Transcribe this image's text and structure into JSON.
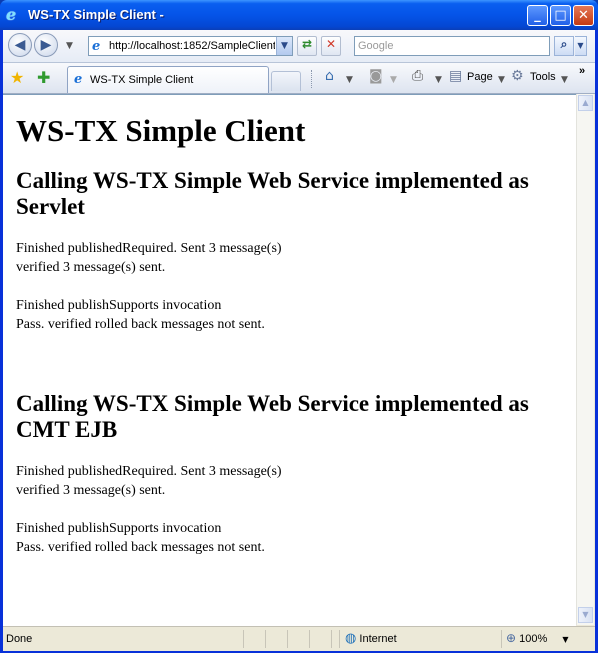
{
  "window": {
    "title": "WS-TX Simple Client -",
    "minimize_label": "_",
    "maximize_label": "□",
    "close_label": "✕"
  },
  "nav": {
    "back_glyph": "◀",
    "forward_glyph": "▶",
    "address": "http://localhost:1852/SampleClient",
    "search_placeholder": "Google"
  },
  "tabs": [
    {
      "label": "WS-TX Simple Client"
    }
  ],
  "commands": {
    "page_label": "Page",
    "tools_label": "Tools",
    "more_glyph": "»"
  },
  "content": {
    "heading": "WS-TX Simple Client",
    "sections": [
      {
        "title": "Calling WS-TX Simple Web Service implemented as Servlet",
        "results": [
          {
            "line1": "Finished publishedRequired. Sent 3 message(s)",
            "line2": "verified 3 message(s) sent."
          },
          {
            "line1": "Finished publishSupports invocation",
            "line2": "Pass. verified rolled back messages not sent."
          }
        ]
      },
      {
        "title": "Calling WS-TX Simple Web Service implemented as CMT EJB",
        "results": [
          {
            "line1": "Finished publishedRequired. Sent 3 message(s)",
            "line2": "verified 3 message(s) sent."
          },
          {
            "line1": "Finished publishSupports invocation",
            "line2": "Pass. verified rolled back messages not sent."
          }
        ]
      }
    ]
  },
  "status": {
    "text": "Done",
    "zone": "Internet",
    "zoom": "100%"
  },
  "icons": [
    "ie-logo-icon",
    "back-icon",
    "forward-icon",
    "refresh-icon",
    "stop-icon",
    "search-icon",
    "favorites-star-icon",
    "add-favorites-icon",
    "home-icon",
    "feeds-icon",
    "print-icon",
    "page-icon",
    "tools-gear-icon",
    "globe-icon",
    "zoom-icon"
  ]
}
